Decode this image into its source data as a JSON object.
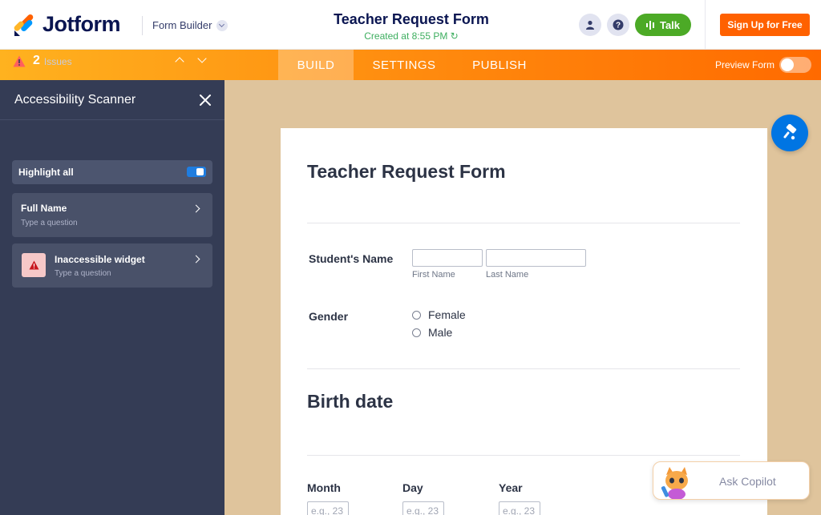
{
  "header": {
    "logo_text": "Jotform",
    "builder_label": "Form Builder",
    "title": "Teacher Request Form",
    "subtitle": "Created at 8:55 PM",
    "talk_label": "Talk",
    "signup_label": "Sign Up for Free"
  },
  "nav": {
    "tabs": [
      {
        "label": "BUILD",
        "active": true
      },
      {
        "label": "SETTINGS",
        "active": false
      },
      {
        "label": "PUBLISH",
        "active": false
      }
    ],
    "preview_label": "Preview Form"
  },
  "sidebar": {
    "title": "Accessibility Scanner",
    "issues_count": "2",
    "issues_label": "Issues",
    "highlight_label": "Highlight all",
    "issues": [
      {
        "title": "Full Name",
        "subtitle": "Type a question"
      },
      {
        "title": "Inaccessible widget",
        "subtitle": "Type a question"
      }
    ]
  },
  "form": {
    "title": "Teacher Request Form",
    "student_label": "Student's Name",
    "first_name_sub": "First Name",
    "last_name_sub": "Last Name",
    "gender_label": "Gender",
    "gender_options": [
      "Female",
      "Male"
    ],
    "birth_heading": "Birth date",
    "month_label": "Month",
    "day_label": "Day",
    "year_label": "Year",
    "month_placeholder": "e.g., 23",
    "day_placeholder": "e.g., 23",
    "year_placeholder": "e.g., 23"
  },
  "copilot": {
    "label": "Ask Copilot"
  },
  "colors": {
    "brand_orange": "#ff6100",
    "talk_green": "#4caa26",
    "sidebar_bg": "#343c55",
    "canvas_bg": "#dfc49c",
    "accent_blue": "#0075e3"
  }
}
